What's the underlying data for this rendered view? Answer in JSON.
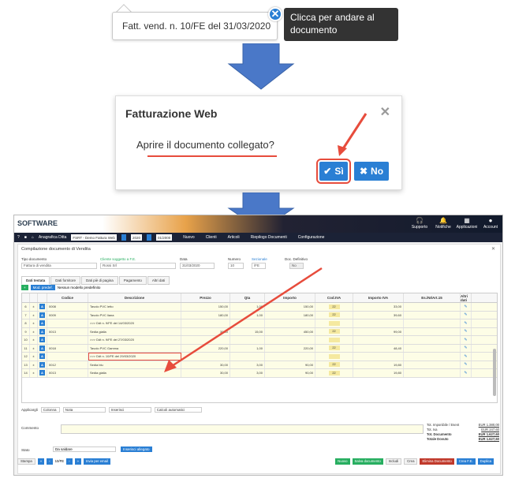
{
  "step1": {
    "document_link": "Fatt. vend. n. 10/FE del 31/03/2020",
    "tooltip_text": "Clicca per andare al documento"
  },
  "dialog": {
    "title": "Fatturazione Web",
    "message": "Aprire il documento collegato?",
    "yes_label": "Sì",
    "no_label": "No"
  },
  "app": {
    "logo": "SOFTWARE",
    "top_icons": [
      {
        "icon": "headset-icon",
        "label": "Supporto"
      },
      {
        "icon": "bell-icon",
        "label": "Notifiche"
      },
      {
        "icon": "grid-icon",
        "label": "Applicazioni"
      },
      {
        "icon": "user-icon",
        "label": "Account"
      }
    ],
    "navbar": {
      "company_label": "Anagrafica Ditta",
      "company_value": "FSRT - Demo Fattura Web",
      "year": "2020",
      "date": "01/2000",
      "menu_new": "Nuovo",
      "menu_clients": "Clienti",
      "menu_items": "Articoli",
      "menu_docs": "Riepilogo Documenti",
      "menu_config": "Configurazione"
    },
    "form": {
      "title": "Compilazione documento di Vendita",
      "doc_type_label": "Tipo documento",
      "doc_type_value": "Fattura di vendita",
      "client_label": "Cliente soggetto a F.E.",
      "client_value": "Rossi Srl",
      "date_label": "Data",
      "date_value": "31/03/2020",
      "number_label": "Numero",
      "number_value": "10",
      "sezionale_label": "Sezionale",
      "sezionale_value": "/FE",
      "definitive_label": "Doc. Definitivo",
      "definitive_value": "No",
      "tabs": [
        "Dati testata",
        "Dati fornitore",
        "Dati piè di pagina",
        "Pagamento",
        "Altri dati"
      ],
      "model_button": "Mod. predef.",
      "model_text": "Nessun modello predefinito"
    },
    "grid": {
      "columns": [
        "Codice",
        "Descrizione",
        "Prezzo",
        "Qta",
        "Importo",
        "Cod.IVA",
        "Importo IVA",
        "Es./NI/Art.15",
        "Altri dati"
      ],
      "rows": [
        {
          "n": "6",
          "code": "0008",
          "desc": "Tavolo PVC letto",
          "price": "150,00",
          "qty": "1,00",
          "amount": "150,00",
          "iva": "22",
          "iva_amt": "33,00"
        },
        {
          "n": "7",
          "code": "0009",
          "desc": "Tavolo PVC liana",
          "price": "180,00",
          "qty": "1,00",
          "amount": "180,00",
          "iva": "22",
          "iva_amt": "39,60"
        },
        {
          "n": "8",
          "code": "",
          "desc": ">>> Ddt n. 9/FE del 14/03/2020",
          "price": "",
          "qty": "",
          "amount": "",
          "iva": "",
          "iva_amt": ""
        },
        {
          "n": "9",
          "code": "0013",
          "desc": "Sedia gialla",
          "price": "30,00",
          "qty": "15,00",
          "amount": "450,00",
          "iva": "22",
          "iva_amt": "99,00"
        },
        {
          "n": "10",
          "code": "",
          "desc": ">>> Ddt n. 9/FE del 27/03/2020",
          "price": "",
          "qty": "",
          "amount": "",
          "iva": "",
          "iva_amt": ""
        },
        {
          "n": "11",
          "code": "0018",
          "desc": "Tavolo PVC Gamma",
          "price": "220,00",
          "qty": "1,00",
          "amount": "220,00",
          "iva": "22",
          "iva_amt": "48,40"
        },
        {
          "n": "12",
          "code": "",
          "desc": ">>> Ddt n. 10/FE del 29/03/2020",
          "price": "",
          "qty": "",
          "amount": "",
          "iva": "",
          "iva_amt": ""
        },
        {
          "n": "13",
          "code": "0012",
          "desc": "Sedia blu",
          "price": "30,00",
          "qty": "3,00",
          "amount": "90,00",
          "iva": "22",
          "iva_amt": "19,80"
        },
        {
          "n": "14",
          "code": "0013",
          "desc": "Sedia gialla",
          "price": "30,00",
          "qty": "3,00",
          "amount": "90,00",
          "iva": "22",
          "iva_amt": "19,80"
        }
      ],
      "highlighted_row": "12"
    },
    "bottom": {
      "apply_label": "Applicargli",
      "apply_value": "Colonna",
      "note_label": "Nota",
      "insert_label": "Inserisci",
      "calc_label": "Calcoli automatici",
      "comment_label": "Commento",
      "status_label": "Stato",
      "status_value": "Da saldare",
      "attach_button": "Inserisci allegato",
      "totals": [
        {
          "label": "Tot. Imponibile / Esent",
          "value": "EUR 1.380,00"
        },
        {
          "label": "Tot. Iva",
          "value": "EUR 247,60"
        },
        {
          "label": "Tot. Documento",
          "value": "EUR 1.627,60"
        },
        {
          "label": "Totale Dovuto",
          "value": "EUR 1.627,60"
        }
      ]
    },
    "actions": {
      "print": "Stampa",
      "page": "10/FE",
      "send_email": "Invia per email",
      "new": "Nuovo",
      "save": "Salva documento",
      "includi": "Includi",
      "crea": "Crea",
      "delete": "Elimina Documento",
      "create_fe": "Crea F.E.",
      "duplicate": "Duplica"
    }
  },
  "colors": {
    "accent_blue": "#2a7fd4",
    "highlight_red": "#e74c3c",
    "arrow_blue": "#4a78c8",
    "tooltip_dark": "#333333"
  }
}
